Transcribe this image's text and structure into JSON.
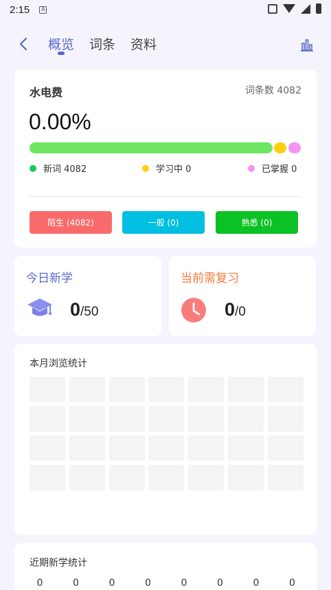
{
  "status_bar": {
    "time": "2:15",
    "notification_icon": "A"
  },
  "header": {
    "tabs": [
      {
        "label": "概览",
        "active": true
      },
      {
        "label": "词条",
        "active": false
      },
      {
        "label": "资料",
        "active": false
      }
    ],
    "back_icon": "chevron-left-icon",
    "stats_icon": "bar-chart-icon"
  },
  "summary": {
    "dict_name": "水电费",
    "entry_count": "词条数 4082",
    "percent": "0.00%",
    "progress": {
      "new": 4082,
      "learning": 0,
      "mastered": 0
    },
    "legend": [
      {
        "label": "新词 4082",
        "color": "#1ac75f"
      },
      {
        "label": "学习中 0",
        "color": "#fdd00f"
      },
      {
        "label": "已掌握 0",
        "color": "#f493f1"
      }
    ],
    "levels": [
      {
        "label": "陌生 (4082)",
        "color": "#f96b6b"
      },
      {
        "label": "一般 (0)",
        "color": "#00bfe0"
      },
      {
        "label": "熟悉 (0)",
        "color": "#0cc123"
      }
    ]
  },
  "today_new": {
    "title": "今日新学",
    "value": "0",
    "goal": "/50",
    "title_color": "#5b68c9"
  },
  "review": {
    "title": "当前需复习",
    "value": "0",
    "goal": "/0",
    "title_color": "#f07a3a"
  },
  "calendar": {
    "title": "本月浏览统计",
    "rows": 4,
    "cols": 7
  },
  "recent": {
    "title": "近期新学统计",
    "values": [
      "0",
      "0",
      "0",
      "0",
      "0",
      "0",
      "0",
      "0"
    ]
  }
}
